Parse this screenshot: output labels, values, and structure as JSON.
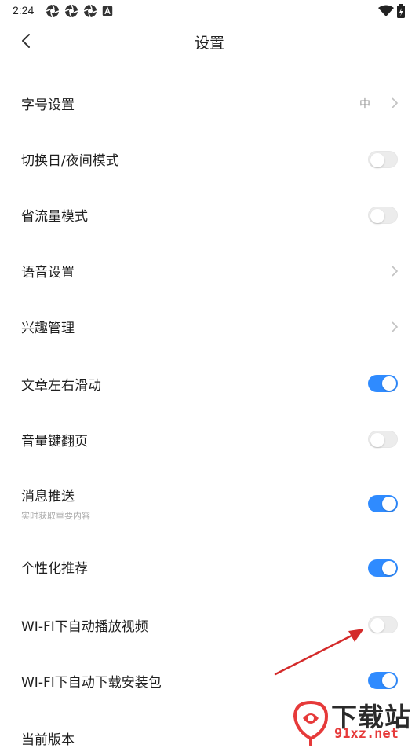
{
  "status_bar": {
    "time": "2:24"
  },
  "header": {
    "title": "设置"
  },
  "settings": [
    {
      "label": "字号设置",
      "value": "中",
      "type": "link"
    },
    {
      "label": "切换日/夜间模式",
      "type": "toggle",
      "on": false
    },
    {
      "label": "省流量模式",
      "type": "toggle",
      "on": false
    },
    {
      "label": "语音设置",
      "type": "link"
    },
    {
      "label": "兴趣管理",
      "type": "link"
    },
    {
      "label": "文章左右滑动",
      "type": "toggle",
      "on": true
    },
    {
      "label": "音量键翻页",
      "type": "toggle",
      "on": false
    },
    {
      "label": "消息推送",
      "sublabel": "实时获取重要内容",
      "type": "toggle",
      "on": true
    },
    {
      "label": "个性化推荐",
      "type": "toggle",
      "on": true
    },
    {
      "label": "WI-FI下自动播放视频",
      "type": "toggle",
      "on": false
    },
    {
      "label": "WI-FI下自动下载安装包",
      "type": "toggle",
      "on": true
    },
    {
      "label": "当前版本",
      "type": "static"
    }
  ],
  "watermark": {
    "name": "下载站",
    "url": "91xz.net"
  },
  "colors": {
    "accent": "#2f8bff",
    "annotation_arrow": "#d42a2a"
  }
}
